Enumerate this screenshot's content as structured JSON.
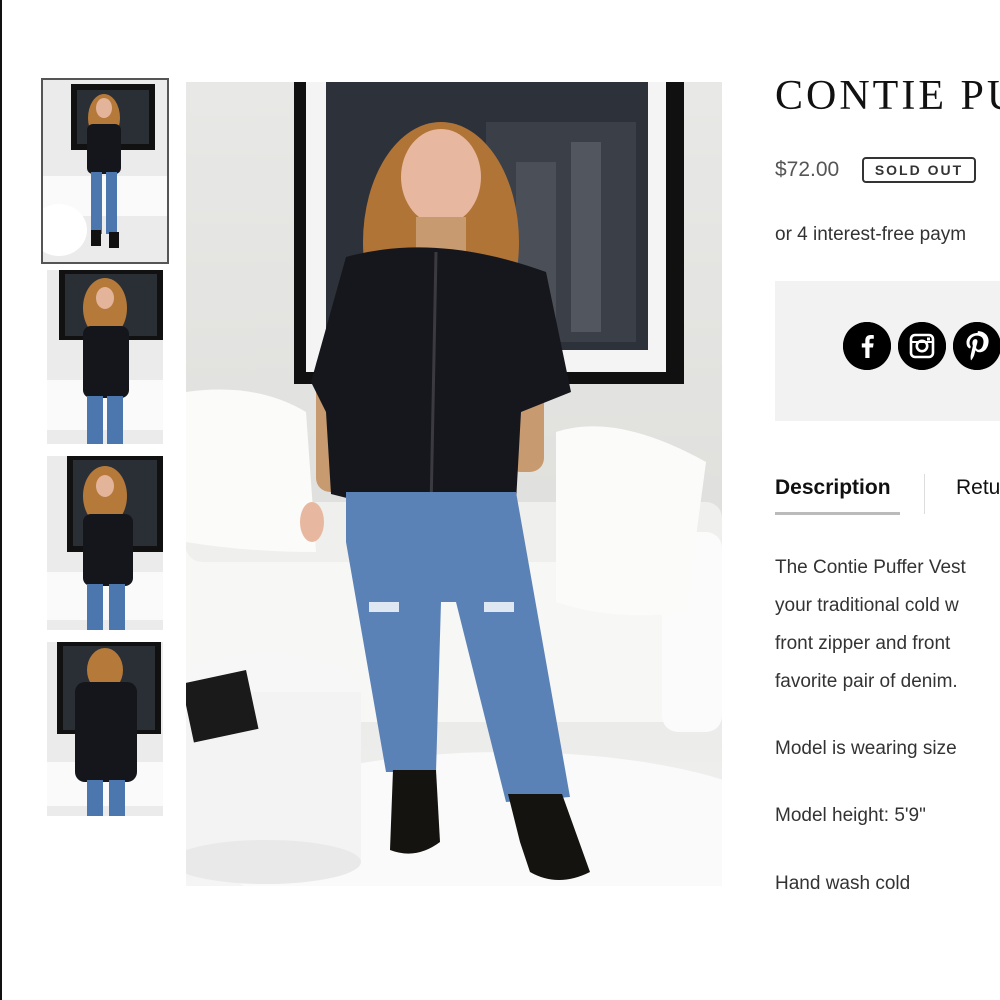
{
  "product": {
    "title": "CONTIE PU",
    "price": "$72.00",
    "sold_out_label": "SOLD OUT",
    "afterpay_text": "or 4 interest-free paym"
  },
  "share": {
    "icons": [
      "facebook-icon",
      "instagram-icon",
      "pinterest-icon"
    ]
  },
  "tabs": {
    "description": "Description",
    "returns": "Retu"
  },
  "description": {
    "lines": [
      "The Contie Puffer Vest",
      "your traditional cold w",
      "front zipper and front",
      "favorite pair of denim."
    ],
    "model_size": "Model is wearing size",
    "model_height": "Model height: 5'9\"",
    "care": "Hand wash cold"
  },
  "gallery": {
    "thumbnail_count": 4
  }
}
